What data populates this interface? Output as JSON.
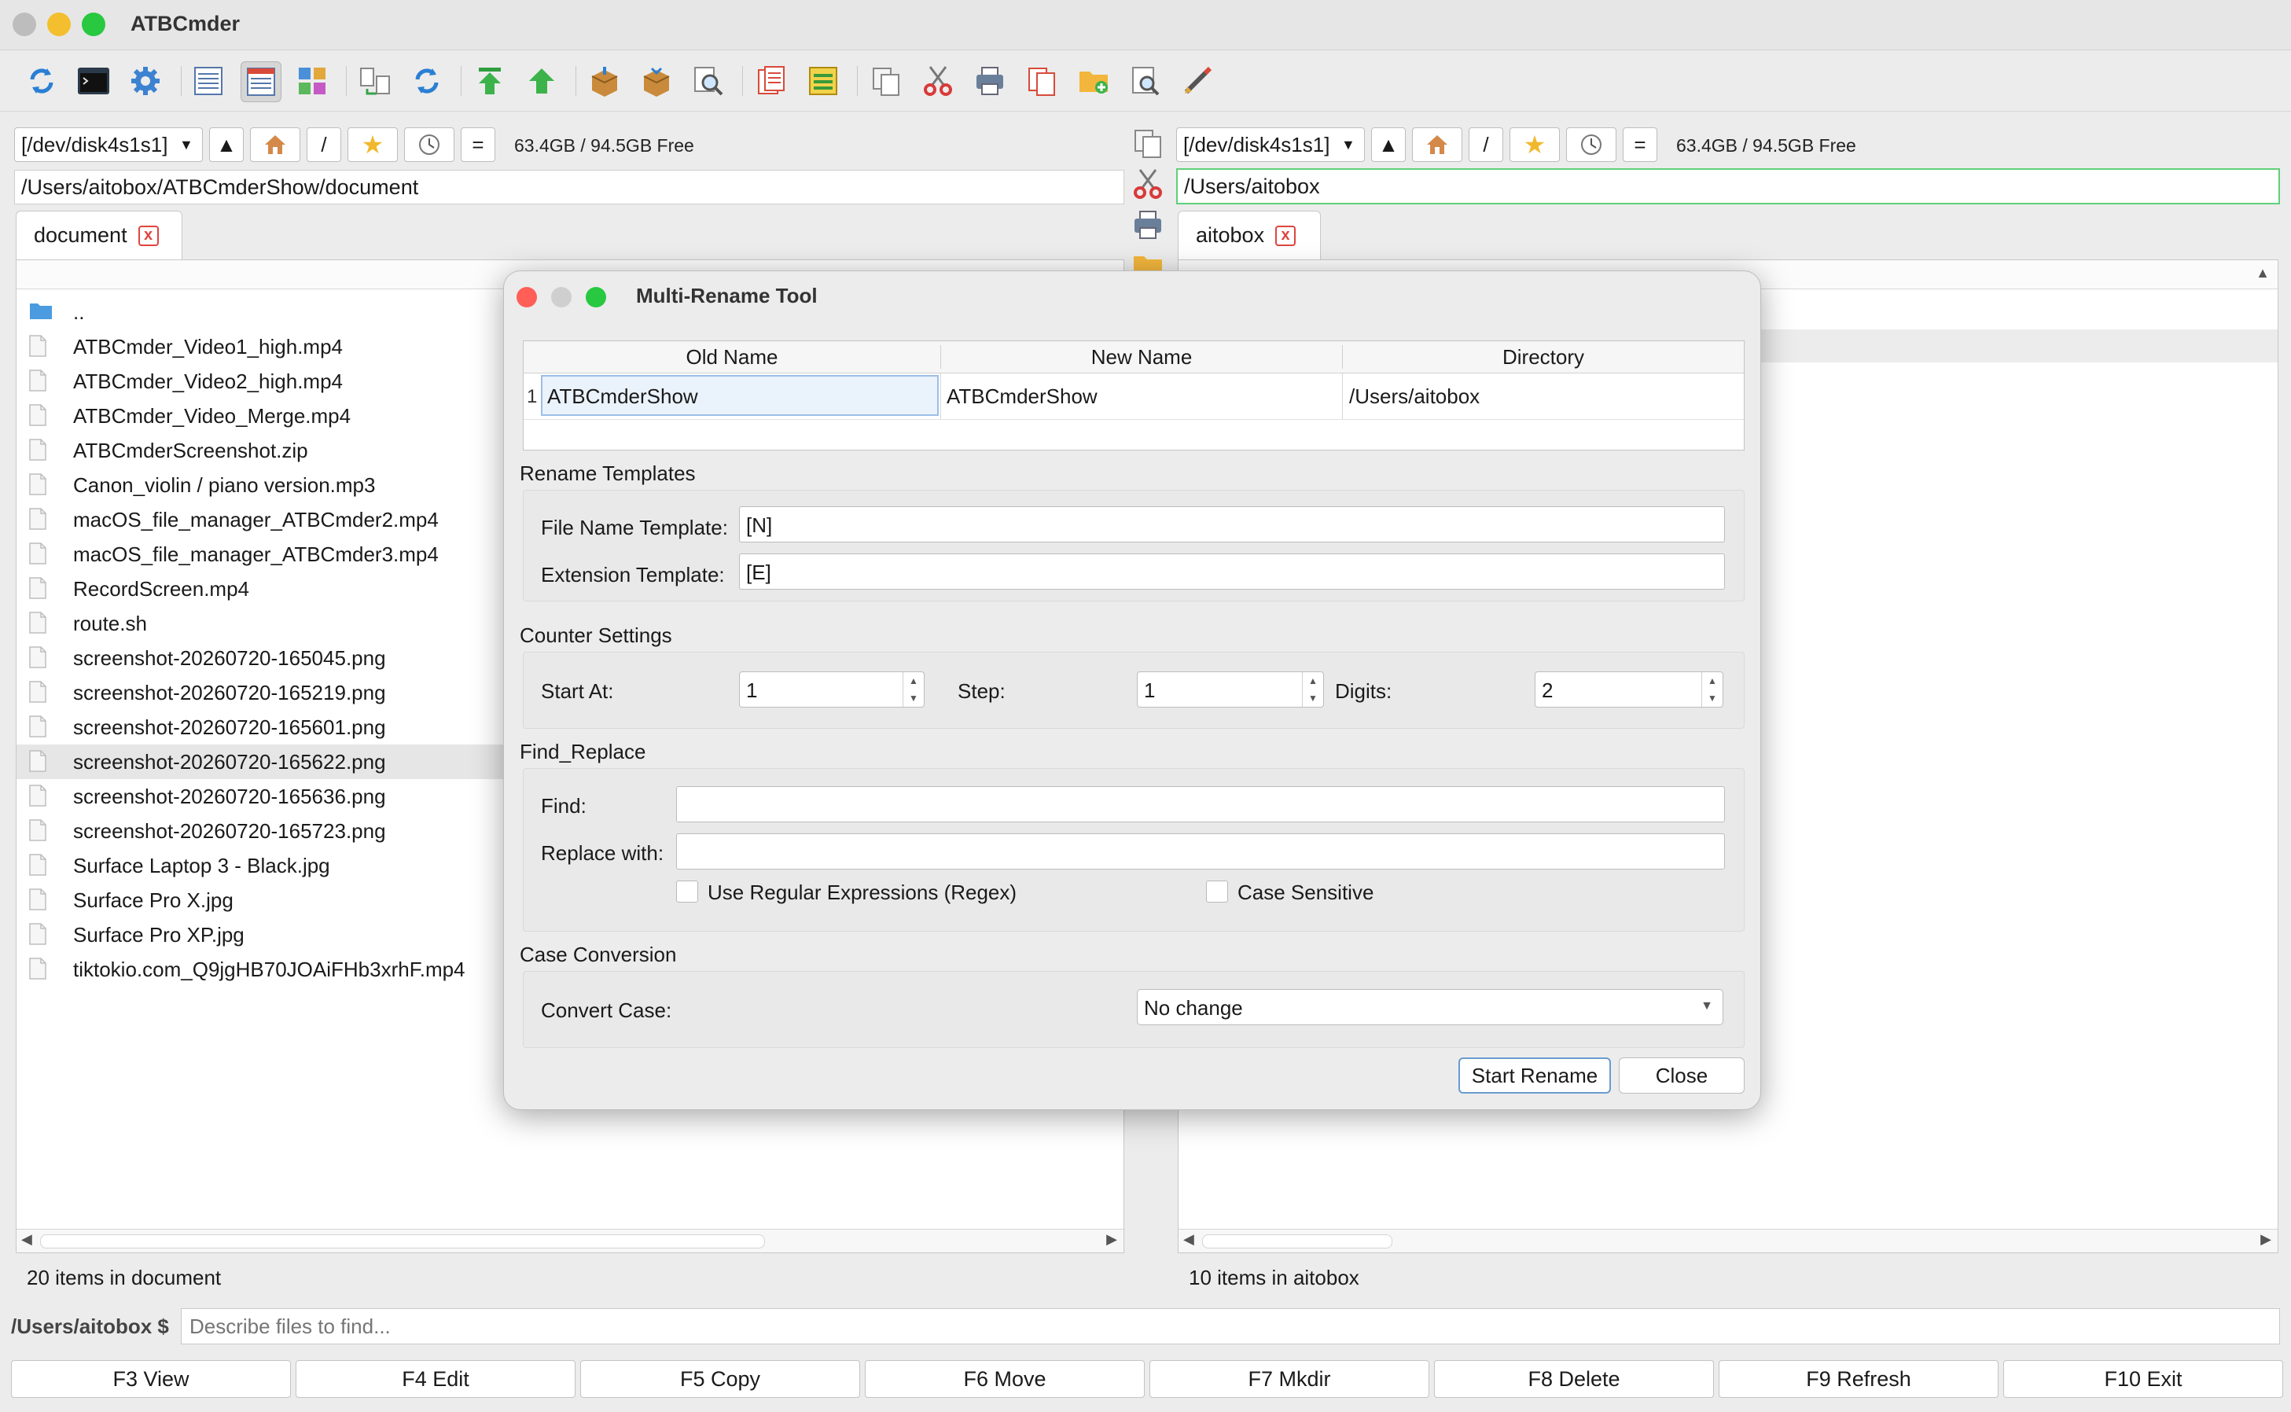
{
  "window": {
    "title": "ATBCmder"
  },
  "toolbar": {
    "icons": [
      "refresh-icon",
      "terminal-icon",
      "settings-gear-icon",
      "brief-view-icon",
      "full-view-icon",
      "thumbnail-view-icon",
      "compare-dirs-icon",
      "sync-dirs-icon",
      "go-root-icon",
      "go-up-icon",
      "pack-icon",
      "unpack-icon",
      "find-files-icon",
      "multi-rename-icon",
      "split-file-icon",
      "copy-icon",
      "cut-icon",
      "print-icon",
      "paste-icon",
      "new-folder-icon",
      "view-file-icon",
      "edit-file-icon"
    ]
  },
  "left_panel": {
    "drive": "[/dev/disk4s1s1]",
    "up_label": "▲",
    "root_label": "/",
    "equal_label": "=",
    "free_space": "63.4GB / 94.5GB Free",
    "path": "/Users/aitobox/ATBCmderShow/document",
    "tab_label": "document",
    "tab_close": "x",
    "files": [
      {
        "name": "..",
        "type": "folder"
      },
      {
        "name": "ATBCmder_Video1_high.mp4",
        "type": "file"
      },
      {
        "name": "ATBCmder_Video2_high.mp4",
        "type": "file"
      },
      {
        "name": "ATBCmder_Video_Merge.mp4",
        "type": "file"
      },
      {
        "name": "ATBCmderScreenshot.zip",
        "type": "file"
      },
      {
        "name": "Canon_violin / piano version.mp3",
        "type": "file"
      },
      {
        "name": "macOS_file_manager_ATBCmder2.mp4",
        "type": "file"
      },
      {
        "name": "macOS_file_manager_ATBCmder3.mp4",
        "type": "file"
      },
      {
        "name": "RecordScreen.mp4",
        "type": "file"
      },
      {
        "name": "route.sh",
        "type": "file"
      },
      {
        "name": "screenshot-20260720-165045.png",
        "type": "file"
      },
      {
        "name": "screenshot-20260720-165219.png",
        "type": "file"
      },
      {
        "name": "screenshot-20260720-165601.png",
        "type": "file"
      },
      {
        "name": "screenshot-20260720-165622.png",
        "type": "file",
        "selected": true
      },
      {
        "name": "screenshot-20260720-165636.png",
        "type": "file"
      },
      {
        "name": "screenshot-20260720-165723.png",
        "type": "file"
      },
      {
        "name": "Surface Laptop 3 - Black.jpg",
        "type": "file"
      },
      {
        "name": "Surface Pro X.jpg",
        "type": "file"
      },
      {
        "name": "Surface Pro XP.jpg",
        "type": "file"
      },
      {
        "name": "tiktokio.com_Q9jgHB70JOAiFHb3xrhF.mp4",
        "type": "file"
      }
    ],
    "status": "20 items in document"
  },
  "right_panel": {
    "drive": "[/dev/disk4s1s1]",
    "up_label": "▲",
    "root_label": "/",
    "equal_label": "=",
    "free_space": "63.4GB / 94.5GB Free",
    "path": "/Users/aitobox",
    "tab_label": "aitobox",
    "tab_close": "x",
    "status": "10 items in aitobox"
  },
  "command_line": {
    "prompt": "/Users/aitobox $",
    "placeholder": "Describe files to find..."
  },
  "function_keys": [
    "F3 View",
    "F4 Edit",
    "F5 Copy",
    "F6 Move",
    "F7 Mkdir",
    "F8 Delete",
    "F9 Refresh",
    "F10 Exit"
  ],
  "dialog": {
    "title": "Multi-Rename Tool",
    "table": {
      "headers": [
        "Old Name",
        "New Name",
        "Directory"
      ],
      "rows": [
        {
          "index": "1",
          "old_name": "ATBCmderShow",
          "new_name": "ATBCmderShow",
          "directory": "/Users/aitobox"
        }
      ]
    },
    "rename_templates": {
      "section": "Rename Templates",
      "file_name_label": "File Name Template:",
      "file_name_value": "[N]",
      "extension_label": "Extension Template:",
      "extension_value": "[E]"
    },
    "counter": {
      "section": "Counter Settings",
      "start_label": "Start At:",
      "start_value": "1",
      "step_label": "Step:",
      "step_value": "1",
      "digits_label": "Digits:",
      "digits_value": "2"
    },
    "find_replace": {
      "section": "Find_Replace",
      "find_label": "Find:",
      "find_value": "",
      "replace_label": "Replace with:",
      "replace_value": "",
      "regex_label": "Use Regular Expressions (Regex)",
      "case_label": "Case Sensitive"
    },
    "case_conversion": {
      "section": "Case Conversion",
      "label": "Convert Case:",
      "value": "No change"
    },
    "buttons": {
      "start": "Start Rename",
      "close": "Close"
    }
  }
}
